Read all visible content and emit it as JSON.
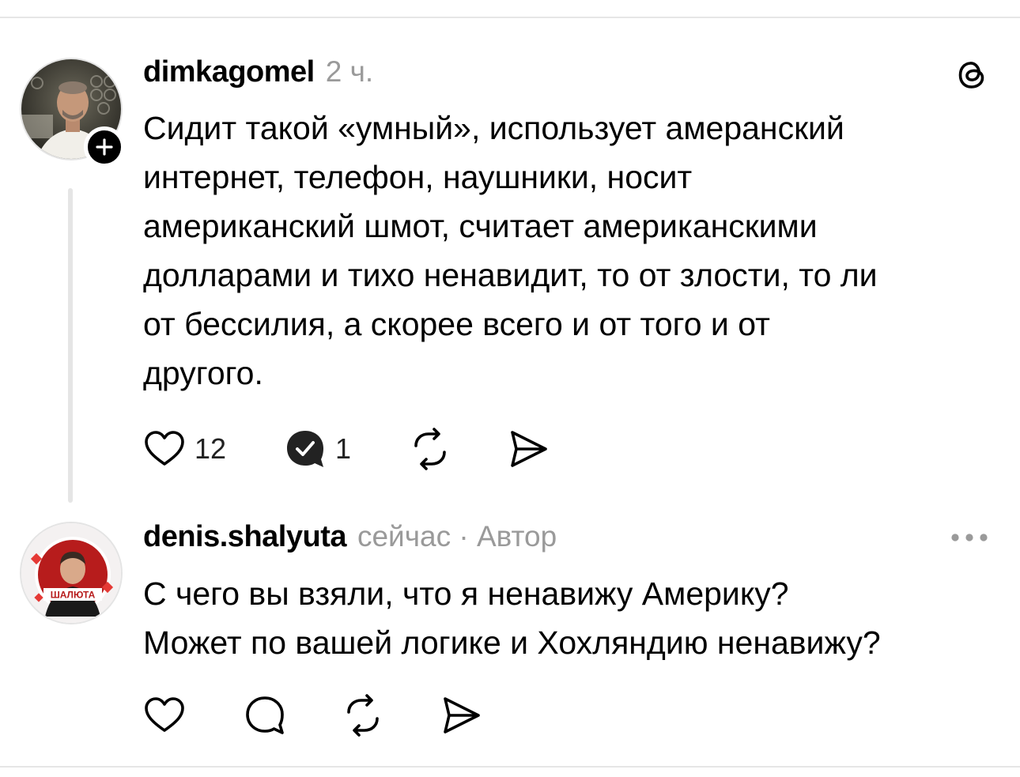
{
  "post": {
    "username": "dimkagomel",
    "time": "2 ч.",
    "text": "Сидит такой «умный», использует амеранский\nинтернет, телефон, наушники, носит\nамериканский шмот, считает американскими\nдолларами и тихо ненавидит, то от злости, то ли\nот бессилия, а скорее всего и от того и от\nдругого.",
    "likes": "12",
    "replies": "1",
    "corner_icon": "threads-logo-icon"
  },
  "reply": {
    "username": "denis.shalyuta",
    "meta": "сейчас · Автор",
    "text": "С чего вы взяли, что я ненавижу Америку?\nМожет по вашей логике и Хохляндию ненавижу?",
    "avatar_caption": "ШАЛЮТА",
    "corner_icon": "more-options-icon"
  },
  "colors": {
    "text": "#000000",
    "muted": "#9a9a9a",
    "divider": "#e6e6e6",
    "thread_line": "#e5e5e5"
  }
}
